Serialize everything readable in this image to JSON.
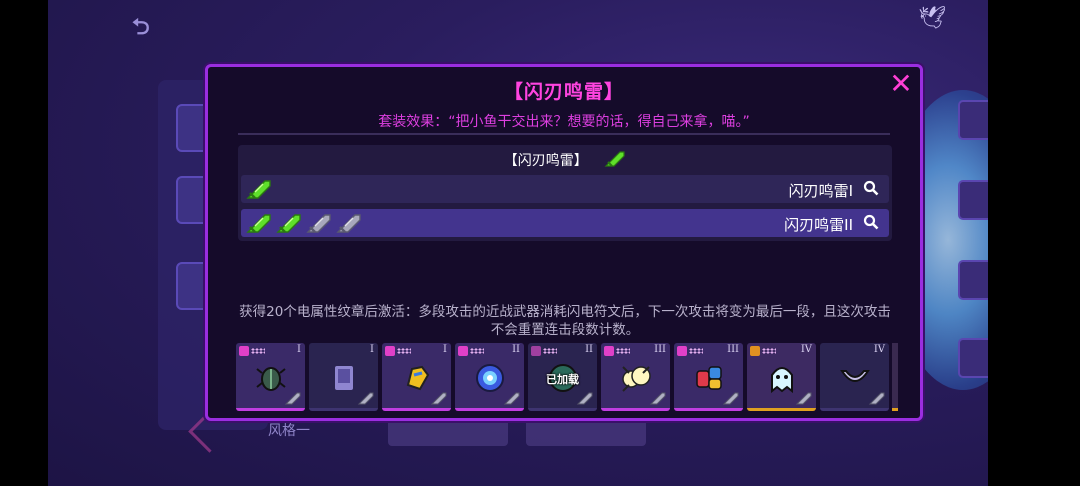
{
  "modal": {
    "title": "【闪刃鸣雷】",
    "close_label": "✕",
    "set_effect": "套装效果：“把小鱼干交出来？想要的话，得自己来拿，喵。”",
    "set_header": "【闪刃鸣雷】",
    "tiers": [
      {
        "label": "闪刃鸣雷I",
        "active_swords": 1,
        "total_swords": 1
      },
      {
        "label": "闪刃鸣雷II",
        "active_swords": 2,
        "total_swords": 4
      }
    ],
    "description": "获得20个电属性纹章后激活：多段攻击的近战武器消耗闪电符文后，下一次攻击将变为最后一段，且这次攻击不会重置连击段数计数。",
    "items": [
      {
        "rank": "I",
        "art": "beetle-icon",
        "style": "pink",
        "overlay": ""
      },
      {
        "rank": "I",
        "art": "scroll-icon",
        "style": "plain",
        "overlay": ""
      },
      {
        "rank": "I",
        "art": "glove-icon",
        "style": "pink",
        "overlay": ""
      },
      {
        "rank": "II",
        "art": "orb-icon",
        "style": "pink",
        "overlay": ""
      },
      {
        "rank": "II",
        "art": "equipped-icon",
        "style": "plain",
        "overlay": "已加载"
      },
      {
        "rank": "III",
        "art": "cloud-icon",
        "style": "pink",
        "overlay": ""
      },
      {
        "rank": "III",
        "art": "jars-icon",
        "style": "pink",
        "overlay": ""
      },
      {
        "rank": "IV",
        "art": "ghost-icon",
        "style": "gold",
        "overlay": ""
      },
      {
        "rank": "IV",
        "art": "claw-icon",
        "style": "plain",
        "overlay": ""
      }
    ]
  },
  "background": {
    "bottom_label": "风格一"
  },
  "colors": {
    "accent": "#ff44e0",
    "active_sword": "#5fe02a",
    "inactive_sword": "#9a9ab0",
    "border": "#9a2ee0"
  }
}
